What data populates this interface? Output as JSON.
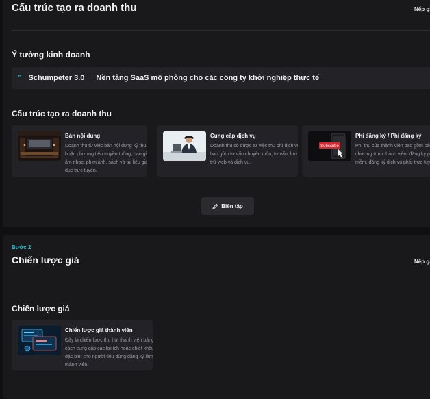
{
  "section1": {
    "title": "Cấu trúc tạo ra doanh thu",
    "collapse_label": "Nếp gấ",
    "idea_heading": "Ý tưởng kinh doanh",
    "idea_quote": "”",
    "idea_name": "Schumpeter 3.0",
    "idea_desc": "Nền tảng SaaS mô phỏng cho các công ty khởi nghiệp thực tế",
    "revenue_heading": "Cấu trúc tạo ra doanh thu",
    "cards": [
      {
        "title": "Bán nội dung",
        "desc": "Doanh thu từ việc bán nội dung kỹ thuật số hoặc phương tiện truyền thông, bao gồm âm nhạc, phim ảnh, sách và tài liệu giáo dục trực tuyến."
      },
      {
        "title": "Cung cấp dịch vụ",
        "desc": "Doanh thu có được từ việc thu phí dịch vụ, bao gồm tư vấn chuyên môn, tư vấn, lưu trữ web và dịch vụ."
      },
      {
        "title": "Phí đăng ký / Phí đăng ký",
        "desc": "Phí thu của thành viên bao gồm các chương trình thành viên, đăng ký phần mềm, đăng ký dịch vụ phát trực tuyến v.v.",
        "thumb_text": "Subscribe"
      }
    ],
    "edit_label": "Biên tập"
  },
  "section2": {
    "step_label": "Bước 2",
    "title": "Chiến lược giá",
    "collapse_label": "Nếp gấ",
    "pricing_heading": "Chiến lược giá",
    "cards": [
      {
        "title": "Chiến lược giá thành viên",
        "desc": "Đây là chiến lược thu hút thành viên bằng cách cung cấp các lợi ích hoặc chiết khấu đặc biệt cho người tiêu dùng đăng ký làm thành viên."
      }
    ]
  },
  "colors": {
    "accent": "#2fb7c7",
    "panel": "#19191c",
    "card": "#232327",
    "background": "#101012"
  }
}
